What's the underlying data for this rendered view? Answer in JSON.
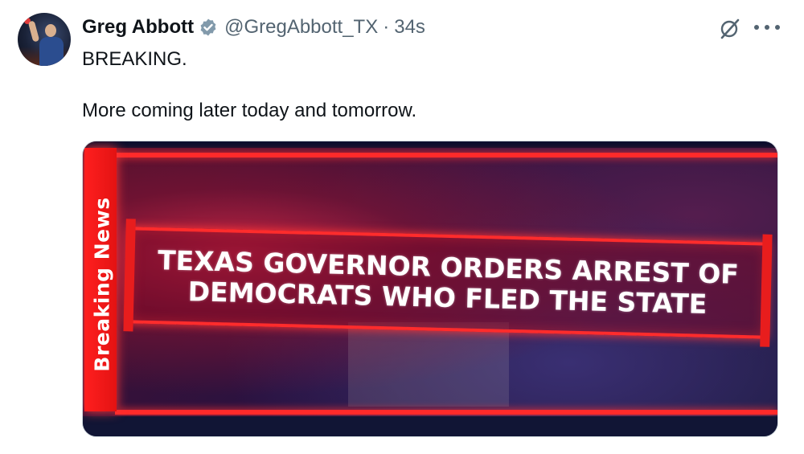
{
  "author": {
    "display_name": "Greg Abbott",
    "handle": "@GregAbbott_TX",
    "separator": "·",
    "timestamp": "34s",
    "verified_badge_color": "#829aab"
  },
  "tweet": {
    "line1": "BREAKING.",
    "line2": "More coming later today and tomorrow."
  },
  "media": {
    "side_label": "Breaking News",
    "headline_line1": "TEXAS GOVERNOR ORDERS ARREST OF",
    "headline_line2": "DEMOCRATS WHO FLED THE STATE",
    "accent_color": "#ff2a2a"
  },
  "icons": {
    "grok": "grok-icon",
    "more": "more-icon",
    "verified": "verified-badge-icon"
  }
}
